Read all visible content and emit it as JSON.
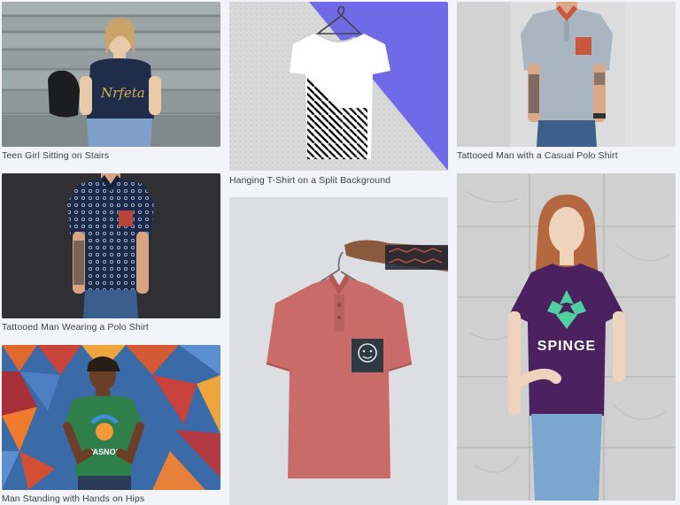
{
  "gallery": {
    "items": [
      {
        "title": "Teen Girl Sitting on Stairs"
      },
      {
        "title": "Hanging T-Shirt on a Split Background"
      },
      {
        "title": "Tattooed Man with a Casual Polo Shirt"
      },
      {
        "title": "Tattooed Man Wearing a Polo Shirt"
      },
      {
        "title": "Man Standing with Hands on Hips"
      },
      {
        "title": "SPINGE"
      },
      {
        "title": "Nrfeta"
      },
      {
        "title": "PASNOS"
      }
    ]
  }
}
